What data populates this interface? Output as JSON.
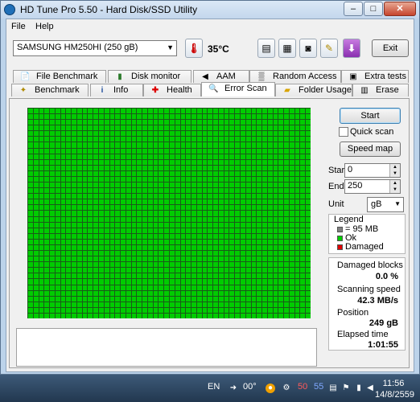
{
  "window": {
    "title": "HD Tune Pro 5.50 - Hard Disk/SSD Utility",
    "controls": [
      "–",
      "□",
      "✕"
    ]
  },
  "menu": {
    "file": "File",
    "help": "Help"
  },
  "toolbar": {
    "drive": "SAMSUNG HM250HI (250 gB)",
    "temperature": "35",
    "temperature_unit": "°C",
    "exit_label": "Exit"
  },
  "tabs_top": [
    {
      "label": "File Benchmark",
      "icon": "file-benchmark-icon"
    },
    {
      "label": "Disk monitor",
      "icon": "disk-monitor-icon"
    },
    {
      "label": "AAM",
      "icon": "speaker-icon"
    },
    {
      "label": "Random Access",
      "icon": "random-access-icon"
    },
    {
      "label": "Extra tests",
      "icon": "extra-tests-icon"
    }
  ],
  "tabs_bottom": [
    {
      "label": "Benchmark",
      "icon": "benchmark-icon"
    },
    {
      "label": "Info",
      "icon": "info-icon"
    },
    {
      "label": "Health",
      "icon": "health-cross-icon"
    },
    {
      "label": "Error Scan",
      "icon": "magnifier-icon",
      "active": true
    },
    {
      "label": "Folder Usage",
      "icon": "folder-icon"
    },
    {
      "label": "Erase",
      "icon": "trash-icon"
    }
  ],
  "scan": {
    "start_button": "Start",
    "quick_scan_label": "Quick scan",
    "speed_map_button": "Speed map",
    "start_label": "Start",
    "start_value": "0",
    "end_label": "End",
    "end_value": "250",
    "unit_label": "Unit",
    "unit_value": "gB"
  },
  "legend": {
    "title": "Legend",
    "block_size": "= 95 MB",
    "ok": "Ok",
    "damaged": "Damaged",
    "colors": {
      "block": "#808080",
      "ok": "#00cc00",
      "damaged": "#e00000"
    }
  },
  "stats": {
    "damaged_label": "Damaged blocks",
    "damaged_value": "0.0 %",
    "speed_label": "Scanning speed",
    "speed_value": "42.3 MB/s",
    "position_label": "Position",
    "position_value": "249 gB",
    "elapsed_label": "Elapsed time",
    "elapsed_value": "1:01:55"
  },
  "scan_grid": {
    "columns": 52,
    "rows": 37,
    "completed_fraction": 1.0,
    "block_color": "#00cc00",
    "line_color": "#1a5a1a"
  },
  "taskbar": {
    "language": "EN",
    "weather": "00°",
    "tray_50": "50",
    "tray_55": "55",
    "time": "11:56",
    "date": "14/8/2559"
  }
}
